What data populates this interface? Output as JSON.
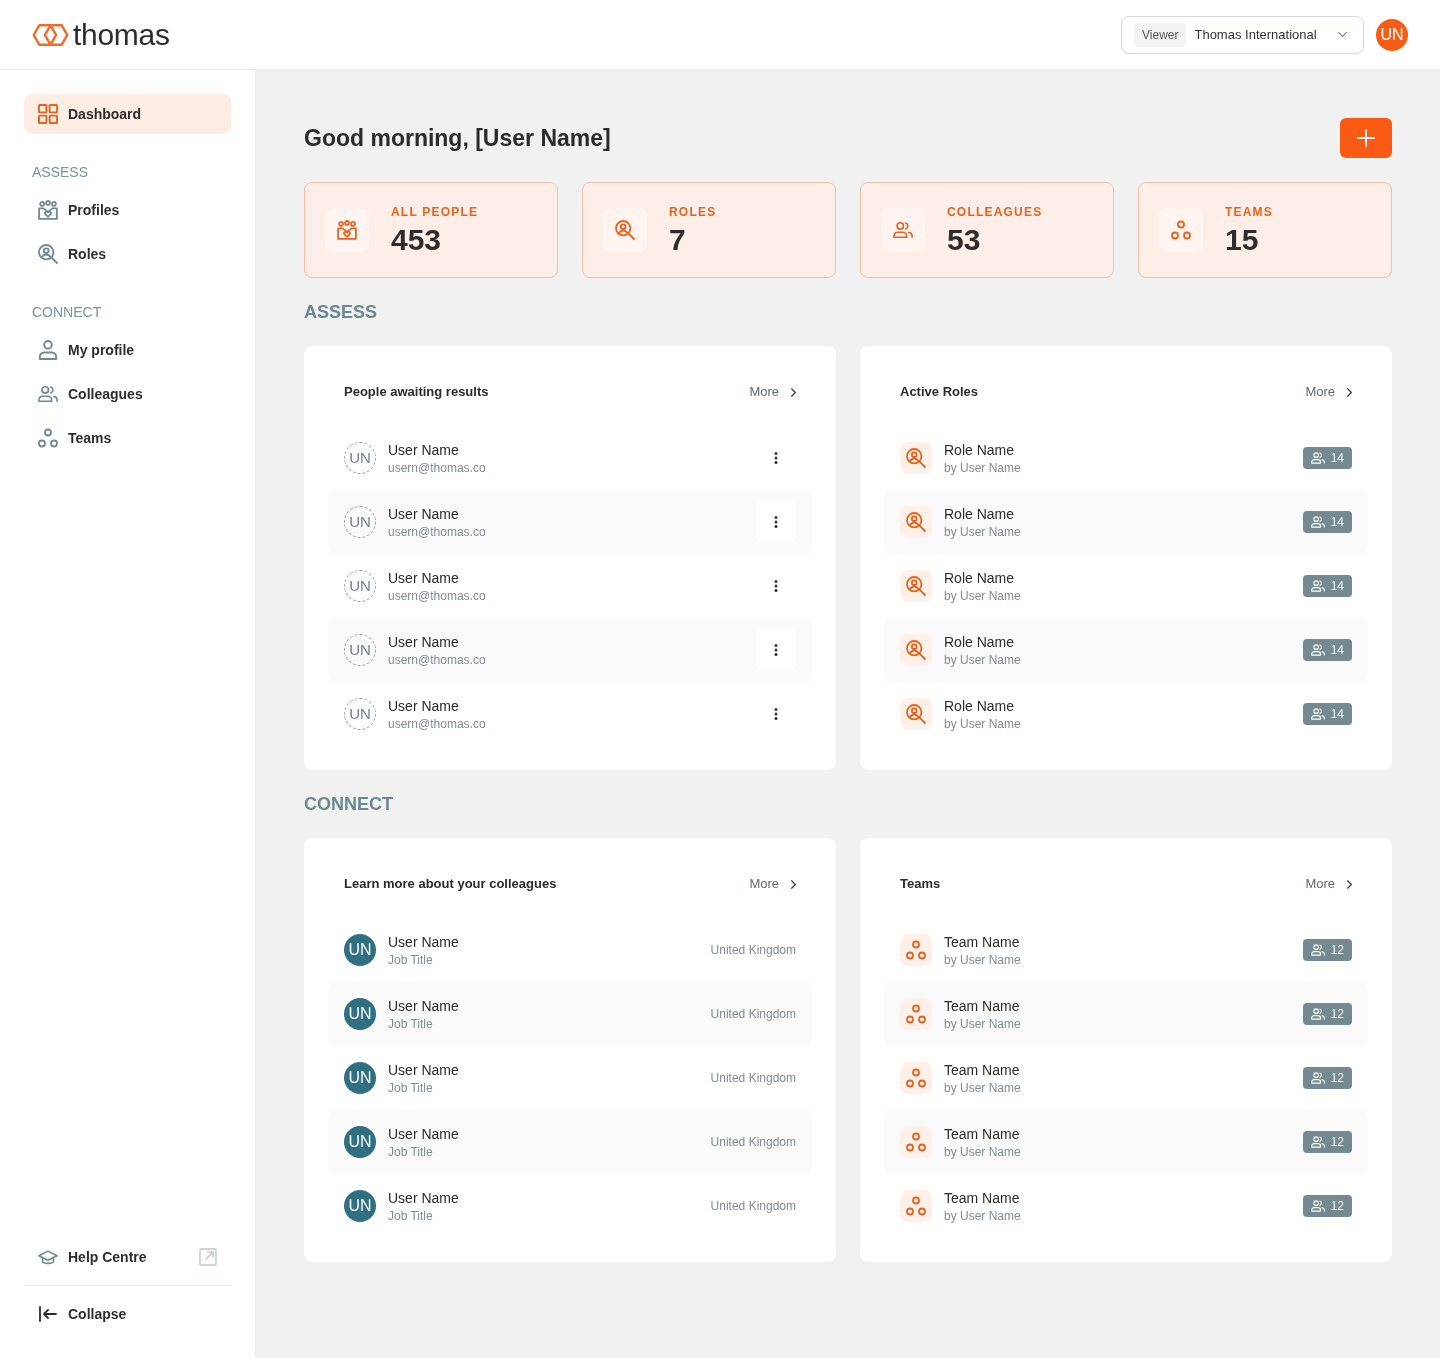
{
  "header": {
    "brand": "thomas",
    "role_tag": "Viewer",
    "organization": "Thomas International",
    "avatar_initials": "UN"
  },
  "sidebar": {
    "items": [
      {
        "kind": "dashboard",
        "label": "Dashboard",
        "selected": true
      }
    ],
    "sections": [
      {
        "title": "ASSESS",
        "items": [
          {
            "kind": "profiles",
            "label": "Profiles",
            "selected": false
          },
          {
            "kind": "roles",
            "label": "Roles",
            "selected": false
          }
        ]
      },
      {
        "title": "CONNECT",
        "items": [
          {
            "kind": "my_profile",
            "label": "My profile",
            "selected": false
          },
          {
            "kind": "colleagues",
            "label": "Colleagues",
            "selected": false
          },
          {
            "kind": "teams",
            "label": "Teams",
            "selected": false
          }
        ]
      }
    ],
    "footer": [
      {
        "kind": "help",
        "label": "Help Centre"
      },
      {
        "kind": "collapse",
        "label": "Collapse"
      }
    ]
  },
  "greeting": "Good morning, [User Name]",
  "stats": [
    {
      "kind": "people",
      "label": "ALL PEOPLE",
      "value": "453"
    },
    {
      "kind": "roles",
      "label": "ROLES",
      "value": "7"
    },
    {
      "kind": "colleagues",
      "label": "COLLEAGUES",
      "value": "53"
    },
    {
      "kind": "teams",
      "label": "TEAMS",
      "value": "15"
    }
  ],
  "sections": [
    {
      "title": "ASSESS",
      "panels": [
        {
          "kind": "awaiting",
          "title": "People awaiting results",
          "more": "More",
          "rows": [
            {
              "initials": "UN",
              "name": "User Name",
              "email": "usern@thomas.co"
            },
            {
              "initials": "UN",
              "name": "User Name",
              "email": "usern@thomas.co"
            },
            {
              "initials": "UN",
              "name": "User Name",
              "email": "usern@thomas.co"
            },
            {
              "initials": "UN",
              "name": "User Name",
              "email": "usern@thomas.co"
            },
            {
              "initials": "UN",
              "name": "User Name",
              "email": "usern@thomas.co"
            }
          ]
        },
        {
          "kind": "roles",
          "title": "Active Roles",
          "more": "More",
          "rows": [
            {
              "name": "Role Name",
              "owner": "by User Name",
              "count": "14"
            },
            {
              "name": "Role Name",
              "owner": "by User Name",
              "count": "14"
            },
            {
              "name": "Role Name",
              "owner": "by User Name",
              "count": "14"
            },
            {
              "name": "Role Name",
              "owner": "by User Name",
              "count": "14"
            },
            {
              "name": "Role Name",
              "owner": "by User Name",
              "count": "14"
            }
          ]
        }
      ]
    },
    {
      "title": "CONNECT",
      "panels": [
        {
          "kind": "colleagues",
          "title": "Learn more about your colleagues",
          "more": "More",
          "rows": [
            {
              "initials": "UN",
              "name": "User Name",
              "job_title": "Job Title",
              "country": "United Kingdom"
            },
            {
              "initials": "UN",
              "name": "User Name",
              "job_title": "Job Title",
              "country": "United Kingdom"
            },
            {
              "initials": "UN",
              "name": "User Name",
              "job_title": "Job Title",
              "country": "United Kingdom"
            },
            {
              "initials": "UN",
              "name": "User Name",
              "job_title": "Job Title",
              "country": "United Kingdom"
            },
            {
              "initials": "UN",
              "name": "User Name",
              "job_title": "Job Title",
              "country": "United Kingdom"
            }
          ]
        },
        {
          "kind": "teams",
          "title": "Teams",
          "more": "More",
          "rows": [
            {
              "name": "Team Name",
              "owner": "by User Name",
              "count": "12"
            },
            {
              "name": "Team Name",
              "owner": "by User Name",
              "count": "12"
            },
            {
              "name": "Team Name",
              "owner": "by User Name",
              "count": "12"
            },
            {
              "name": "Team Name",
              "owner": "by User Name",
              "count": "12"
            },
            {
              "name": "Team Name",
              "owner": "by User Name",
              "count": "12"
            }
          ]
        }
      ]
    }
  ]
}
